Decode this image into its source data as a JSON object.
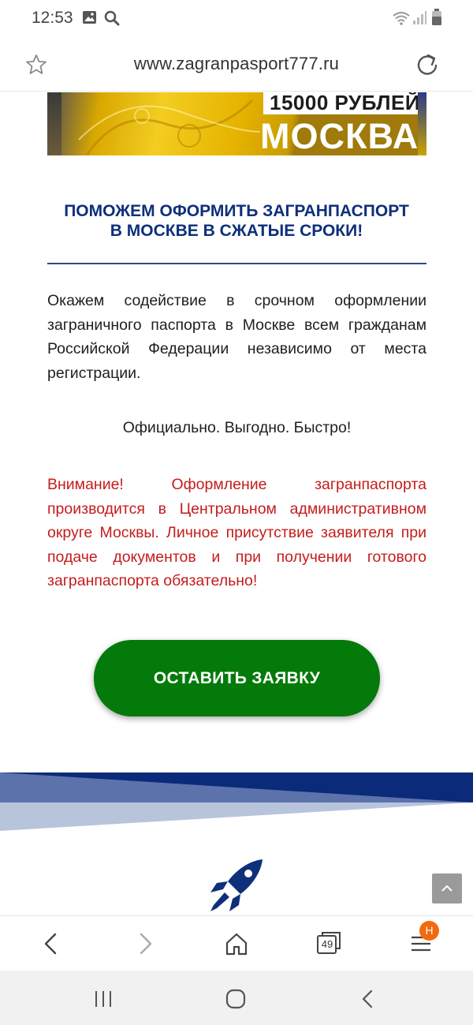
{
  "status_bar": {
    "time": "12:53",
    "icons": [
      "image-icon",
      "search-icon",
      "wifi-icon",
      "signal-icon",
      "battery-icon"
    ]
  },
  "address_bar": {
    "url": "www.zagranpasport777.ru",
    "icons": [
      "star-icon",
      "reload-icon"
    ]
  },
  "banner": {
    "price": "15000 РУБЛЕЙ",
    "city": "МОСКВА"
  },
  "main": {
    "headline_line1": "ПОМОЖЕМ ОФОРМИТЬ ЗАГРАНПАСПОРТ",
    "headline_line2": "В МОСКВЕ В СЖАТЫЕ СРОКИ!",
    "paragraph": "Окажем содействие в срочном оформлении заграничного паспорта в Москве всем гражданам Российской Федерации независимо от места регистрации.",
    "slogan": "Официально. Выгодно. Быстро!",
    "warning": "Внимание! Оформление загранпаспорта производится в Центральном административном округе Москвы. Личное присутствие заявителя при подаче документов и при получении готового загранпаспорта обязательно!",
    "cta_label": "ОСТАВИТЬ ЗАЯВКУ"
  },
  "colors": {
    "headline": "#0e2f7a",
    "warning": "#c51c1c",
    "cta": "#047a0a",
    "wave_dark": "#0b2a7a",
    "badge": "#f26a10"
  },
  "browser_nav": {
    "tab_count": "49",
    "menu_badge": "H",
    "icons": [
      "back-icon",
      "forward-icon",
      "home-icon",
      "tabs-icon",
      "menu-icon"
    ]
  },
  "system_nav": {
    "icons": [
      "recent-apps-icon",
      "home-circle-icon",
      "system-back-icon"
    ]
  }
}
